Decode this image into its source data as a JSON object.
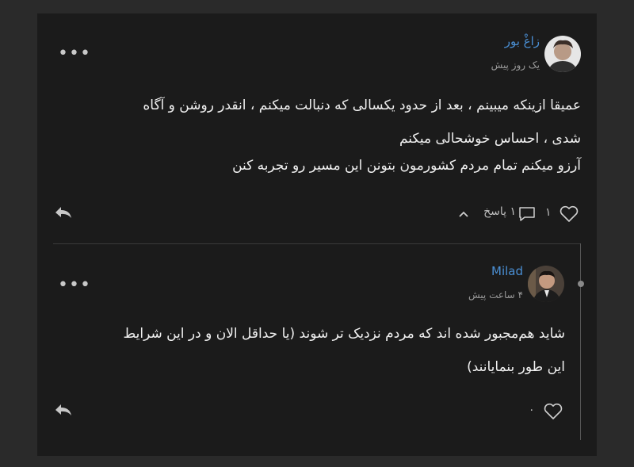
{
  "comments": [
    {
      "author": "زاغْ بور",
      "time": "یک روز پیش",
      "lines": [
        "عمیقا ازینکه میبینم ، بعد از حدود یکسالی که دنبالت میکنم ، انقدر روشن و آگاه",
        "شدی ، احساس خوشحالی میکنم",
        "آرزو میکنم تمام مردم کشورمون بتونن این مسیر رو تجربه کنن"
      ],
      "like_count": "۱",
      "reply_label": "۱ پاسخ"
    },
    {
      "author": "Milad",
      "time": "۴ ساعت پیش",
      "lines": [
        "شاید هم‌مجبور شده اند که مردم نزدیک تر شوند (یا حداقل الان و در این شرایط",
        "این طور بنمایانند)"
      ],
      "like_count": "۰"
    }
  ],
  "icons": {
    "more": "more-dots-icon",
    "reply": "reply-arrow-icon",
    "like": "heart-icon",
    "comment": "comment-bubble-icon",
    "toggle": "chevron-up-icon"
  },
  "colors": {
    "background": "#2a2a2a",
    "card": "#1b1b1b",
    "author_name": "#4a8fd4",
    "text": "#f0f0f0"
  }
}
